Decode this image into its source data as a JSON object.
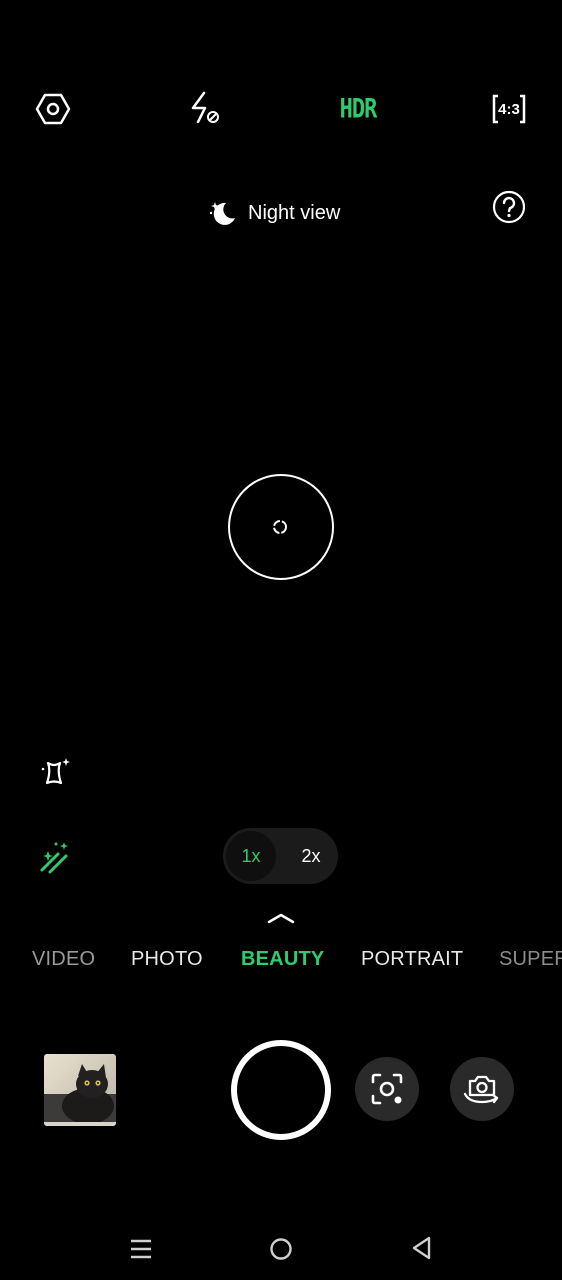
{
  "toolbar": {
    "settings_icon": "hexagon-settings-icon",
    "flash_icon": "flash-off-icon",
    "hdr_label": "HDR",
    "hdr_color": "#2ecc71",
    "ratio_label": "4:3"
  },
  "night_view": {
    "icon": "moon-stars-icon",
    "label": "Night view"
  },
  "help_icon": "question-circle-icon",
  "zoom": {
    "options": [
      "1x",
      "2x"
    ],
    "selected": "1x",
    "active_color": "#2ecc71"
  },
  "modes": {
    "video": "VIDEO",
    "photo": "PHOTO",
    "beauty": "BEAUTY",
    "portrait": "PORTRAIT",
    "super": "SUPER",
    "selected": "BEAUTY",
    "selected_color": "#2ecc71"
  },
  "bottom": {
    "thumbnail": "last-photo-cat-thumbnail",
    "shutter": "shutter-button",
    "lens_icon": "lens-scan-icon",
    "flip_icon": "camera-flip-icon"
  },
  "nav": {
    "menu_icon": "recent-apps-icon",
    "home_icon": "home-icon",
    "back_icon": "back-icon"
  }
}
